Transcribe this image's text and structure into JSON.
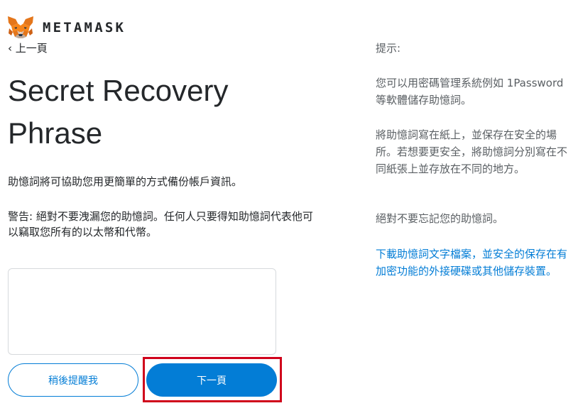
{
  "header": {
    "brand": "METAMASK",
    "back_label": "‹ 上一頁"
  },
  "main": {
    "title": "Secret Recovery Phrase",
    "description": "助憶詞將可協助您用更簡單的方式備份帳戶資訊。",
    "warning": "警告: 絕對不要洩漏您的助憶詞。任何人只要得知助憶詞代表他可以竊取您所有的以太幣和代幣。",
    "remind_later_label": "稍後提醒我",
    "next_label": "下一頁"
  },
  "tips": {
    "title": "提示:",
    "items": [
      "您可以用密碼管理系統例如 1Password 等軟體儲存助憶詞。",
      "將助憶詞寫在紙上，並保存在安全的場所。若想要更安全，將助憶詞分別寫在不同紙張上並存放在不同的地方。",
      "絕對不要忘記您的助憶詞。"
    ],
    "download_link": "下載助憶詞文字檔案，並安全的保存在有加密功能的外接硬碟或其他儲存裝置。"
  },
  "colors": {
    "accent": "#037dd6",
    "highlight": "#d0021b",
    "fox_orange": "#e2761b"
  },
  "icons": {
    "logo": "metamask-fox-icon"
  }
}
